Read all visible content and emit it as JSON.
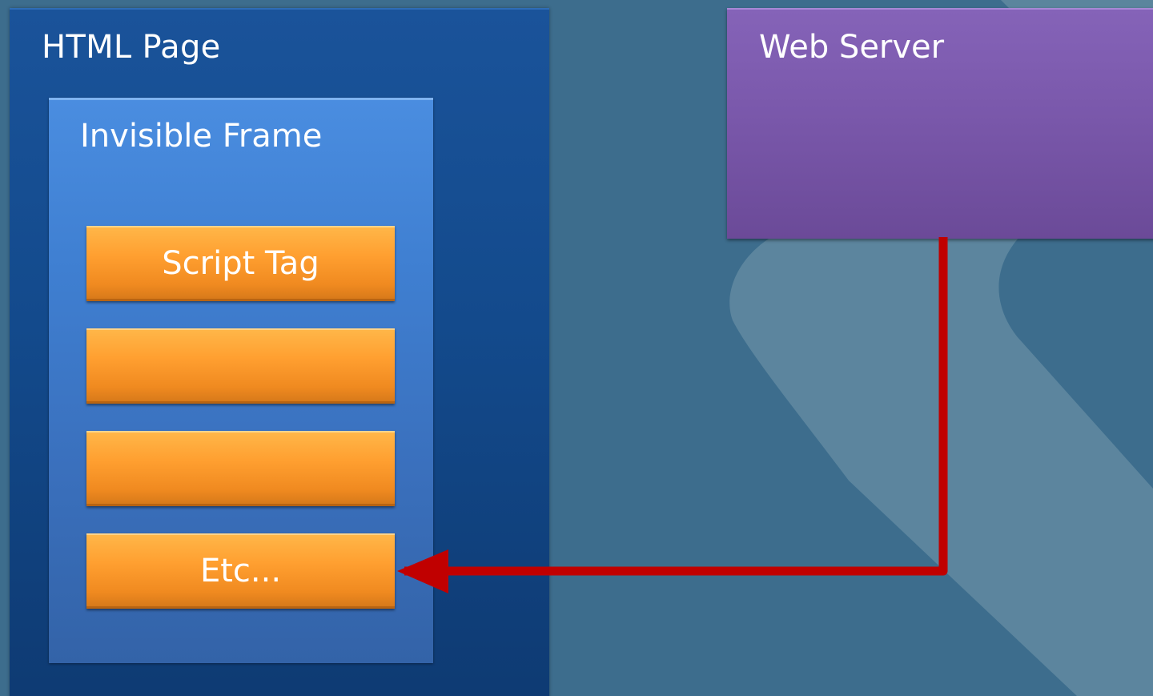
{
  "diagram": {
    "html_page": {
      "title": "HTML Page"
    },
    "invisible_frame": {
      "title": "Invisible Frame"
    },
    "script_tags": [
      {
        "label": "Script Tag"
      },
      {
        "label": ""
      },
      {
        "label": ""
      },
      {
        "label": "Etc..."
      }
    ],
    "web_server": {
      "title": "Web Server"
    }
  },
  "colors": {
    "background": "#3d6d8d",
    "html_page": "#134a8c",
    "invisible_frame": "#3f7fd1",
    "script_tag": "#ff9f30",
    "web_server": "#7a58ab",
    "arrow": "#c00000"
  }
}
